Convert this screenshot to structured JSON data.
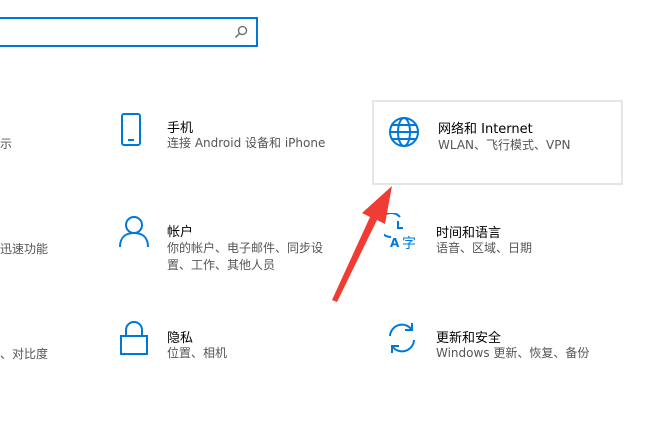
{
  "search": {
    "value": "",
    "placeholder": ""
  },
  "left_fragments": [
    {
      "text": "示"
    },
    {
      "text": "迅速功能"
    },
    {
      "text": "、对比度"
    }
  ],
  "tiles": {
    "phone": {
      "title": "手机",
      "desc": "连接 Android 设备和 iPhone",
      "icon": "phone-icon"
    },
    "network": {
      "title": "网络和 Internet",
      "desc": "WLAN、飞行模式、VPN",
      "icon": "globe-icon"
    },
    "accounts": {
      "title": "帐户",
      "desc_line1": "你的帐户、电子邮件、同步设",
      "desc_line2": "置、工作、其他人员",
      "icon": "person-icon"
    },
    "time_language": {
      "title": "时间和语言",
      "desc": "语音、区域、日期",
      "icon": "time-language-icon"
    },
    "privacy": {
      "title": "隐私",
      "desc": "位置、相机",
      "icon": "lock-icon"
    },
    "update_security": {
      "title": "更新和安全",
      "desc": "Windows 更新、恢复、备份",
      "icon": "sync-icon"
    }
  },
  "colors": {
    "accent": "#0078d7",
    "annotation_arrow": "#f03c32",
    "hover_border": "#e6e6e6"
  }
}
